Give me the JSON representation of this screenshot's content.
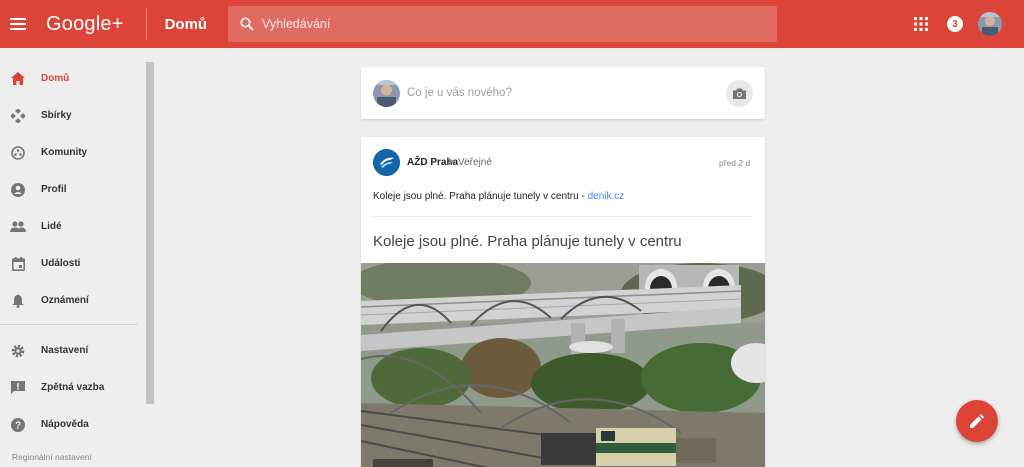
{
  "header": {
    "logo": "Google+",
    "section": "Domů",
    "search_placeholder": "Vyhledávání",
    "notifications_count": "3",
    "accent": "#db4437"
  },
  "sidebar": {
    "items": [
      {
        "label": "Domů",
        "icon": "home-icon",
        "active": true
      },
      {
        "label": "Sbírky",
        "icon": "collections-icon"
      },
      {
        "label": "Komunity",
        "icon": "communities-icon"
      },
      {
        "label": "Profil",
        "icon": "profile-icon"
      },
      {
        "label": "Lidé",
        "icon": "people-icon"
      },
      {
        "label": "Události",
        "icon": "events-icon"
      },
      {
        "label": "Oznámení",
        "icon": "bell-icon"
      }
    ],
    "secondary": [
      {
        "label": "Nastavení",
        "icon": "gear-icon"
      },
      {
        "label": "Zpětná vazba",
        "icon": "feedback-icon"
      },
      {
        "label": "Nápověda",
        "icon": "help-icon"
      }
    ],
    "region": "Regionální nastavení"
  },
  "compose": {
    "placeholder": "Co je u vás nového?"
  },
  "post": {
    "author": "AŽD Praha",
    "audience": "Veřejné",
    "time": "před 2 d",
    "text": "Koleje jsou plné. Praha plánuje tunely v centru - ",
    "link": "denik.cz",
    "link_title": "Koleje jsou plné. Praha plánuje tunely v centru"
  }
}
